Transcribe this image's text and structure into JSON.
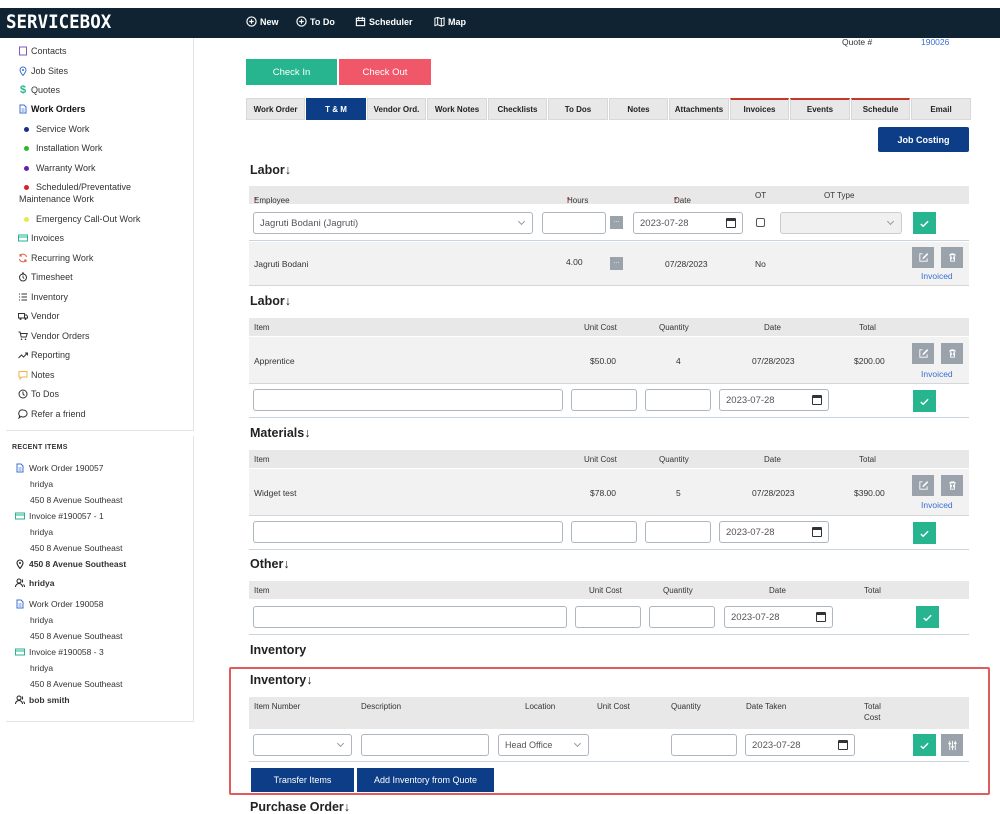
{
  "app": {
    "logo": "SERVICEBOX"
  },
  "topnav": [
    {
      "label": "New",
      "icon": "plus-circle-icon"
    },
    {
      "label": "To Do",
      "icon": "plus-circle-icon"
    },
    {
      "label": "Scheduler",
      "icon": "calendar-icon"
    },
    {
      "label": "Map",
      "icon": "map-icon"
    }
  ],
  "quote": {
    "label": "Quote #",
    "number": "190026"
  },
  "sidebar": {
    "items": [
      {
        "label": "Contacts",
        "icon": "book-icon"
      },
      {
        "label": "Job Sites",
        "icon": "location-pin-icon"
      },
      {
        "label": "Quotes",
        "icon": "dollar-icon"
      },
      {
        "label": "Work Orders",
        "icon": "document-icon"
      },
      {
        "label": "Service Work",
        "dot": "#1a2d8a"
      },
      {
        "label": "Installation Work",
        "dot": "#2db82d"
      },
      {
        "label": "Warranty Work",
        "dot": "#6a1fa8"
      },
      {
        "label": "Scheduled/Preventative",
        "label2": "Maintenance Work",
        "dot": "#e02020"
      },
      {
        "label": "Emergency Call-Out Work",
        "dot": "#e8e84a"
      },
      {
        "label": "Invoices",
        "icon": "invoice-icon"
      },
      {
        "label": "Recurring Work",
        "icon": "recurring-icon"
      },
      {
        "label": "Timesheet",
        "icon": "timesheet-icon"
      },
      {
        "label": "Inventory",
        "icon": "list-icon"
      },
      {
        "label": "Vendor",
        "icon": "truck-icon"
      },
      {
        "label": "Vendor Orders",
        "icon": "cart-icon"
      },
      {
        "label": "Reporting",
        "icon": "trend-icon"
      },
      {
        "label": "Notes",
        "icon": "note-icon"
      },
      {
        "label": "To Dos",
        "icon": "clock-icon"
      },
      {
        "label": "Refer a friend",
        "icon": "chat-icon"
      }
    ]
  },
  "recent": {
    "title": "RECENT ITEMS",
    "items": [
      {
        "label": "Work Order 190057",
        "icon": "document-icon",
        "sub": [
          "hridya",
          "450 8 Avenue Southeast"
        ]
      },
      {
        "label": "Invoice #190057 - 1",
        "icon": "invoice-icon",
        "sub": [
          "hridya",
          "450 8 Avenue Southeast"
        ]
      },
      {
        "label": "450 8 Avenue Southeast",
        "icon": "location-pin-icon",
        "sub": []
      },
      {
        "label": "hridya",
        "icon": "user-icon",
        "sub": []
      },
      {
        "label": "Work Order 190058",
        "icon": "document-icon",
        "sub": [
          "hridya",
          "450 8 Avenue Southeast"
        ]
      },
      {
        "label": "Invoice #190058 - 3",
        "icon": "invoice-icon",
        "sub": [
          "hridya",
          "450 8 Avenue Southeast"
        ]
      },
      {
        "label": "bob smith",
        "icon": "user-icon",
        "sub": []
      }
    ]
  },
  "actions": {
    "check_in": "Check In",
    "check_out": "Check Out",
    "job_costing": "Job Costing"
  },
  "tabs": [
    "Work Order",
    "T & M",
    "Vendor Ord.",
    "Work Notes",
    "Checklists",
    "To Dos",
    "Notes",
    "Attachments",
    "Invoices",
    "Events",
    "Schedule",
    "Email"
  ],
  "labor1": {
    "title": "Labor",
    "headers": {
      "employee": "Employee",
      "hours": "Hours",
      "date": "Date",
      "ot": "OT",
      "ot_type": "OT Type"
    },
    "form": {
      "employee_value": "Jagruti Bodani (Jagruti)",
      "date_value": "2023-07-28"
    },
    "row": {
      "employee": "Jagruti Bodani",
      "hours": "4.00",
      "date": "07/28/2023",
      "ot": "No",
      "status": "Invoiced"
    }
  },
  "labor2": {
    "title": "Labor",
    "headers": {
      "item": "Item",
      "unit_cost": "Unit Cost",
      "quantity": "Quantity",
      "date": "Date",
      "total": "Total"
    },
    "row": {
      "item": "Apprentice",
      "unit_cost": "$50.00",
      "quantity": "4",
      "date": "07/28/2023",
      "total": "$200.00",
      "status": "Invoiced"
    },
    "form": {
      "date_value": "2023-07-28"
    }
  },
  "materials": {
    "title": "Materials",
    "headers": {
      "item": "Item",
      "unit_cost": "Unit Cost",
      "quantity": "Quantity",
      "date": "Date",
      "total": "Total"
    },
    "row": {
      "item": "Widget test",
      "unit_cost": "$78.00",
      "quantity": "5",
      "date": "07/28/2023",
      "total": "$390.00",
      "status": "Invoiced"
    },
    "form": {
      "date_value": "2023-07-28"
    }
  },
  "other": {
    "title": "Other",
    "headers": {
      "item": "Item",
      "unit_cost": "Unit Cost",
      "quantity": "Quantity",
      "date": "Date",
      "total": "Total"
    },
    "form": {
      "date_value": "2023-07-28"
    }
  },
  "inventory_plain": {
    "title": "Inventory"
  },
  "inventory": {
    "title": "Inventory",
    "headers": {
      "item_number": "Item Number",
      "description": "Description",
      "location": "Location",
      "unit_cost": "Unit Cost",
      "quantity": "Quantity",
      "date_taken": "Date Taken",
      "total_cost_1": "Total",
      "total_cost_2": "Cost"
    },
    "form": {
      "location_value": "Head Office",
      "date_value": "2023-07-28"
    },
    "buttons": {
      "transfer": "Transfer Items",
      "add_from_quote": "Add Inventory from Quote"
    }
  },
  "purchase_order": {
    "title": "Purchase Order"
  },
  "colors": {
    "topbar": "#0f2333",
    "check_in": "#26b58f",
    "check_out": "#f0586a",
    "accent_blue": "#0d3d86",
    "highlight_box": "#e05c5c"
  }
}
